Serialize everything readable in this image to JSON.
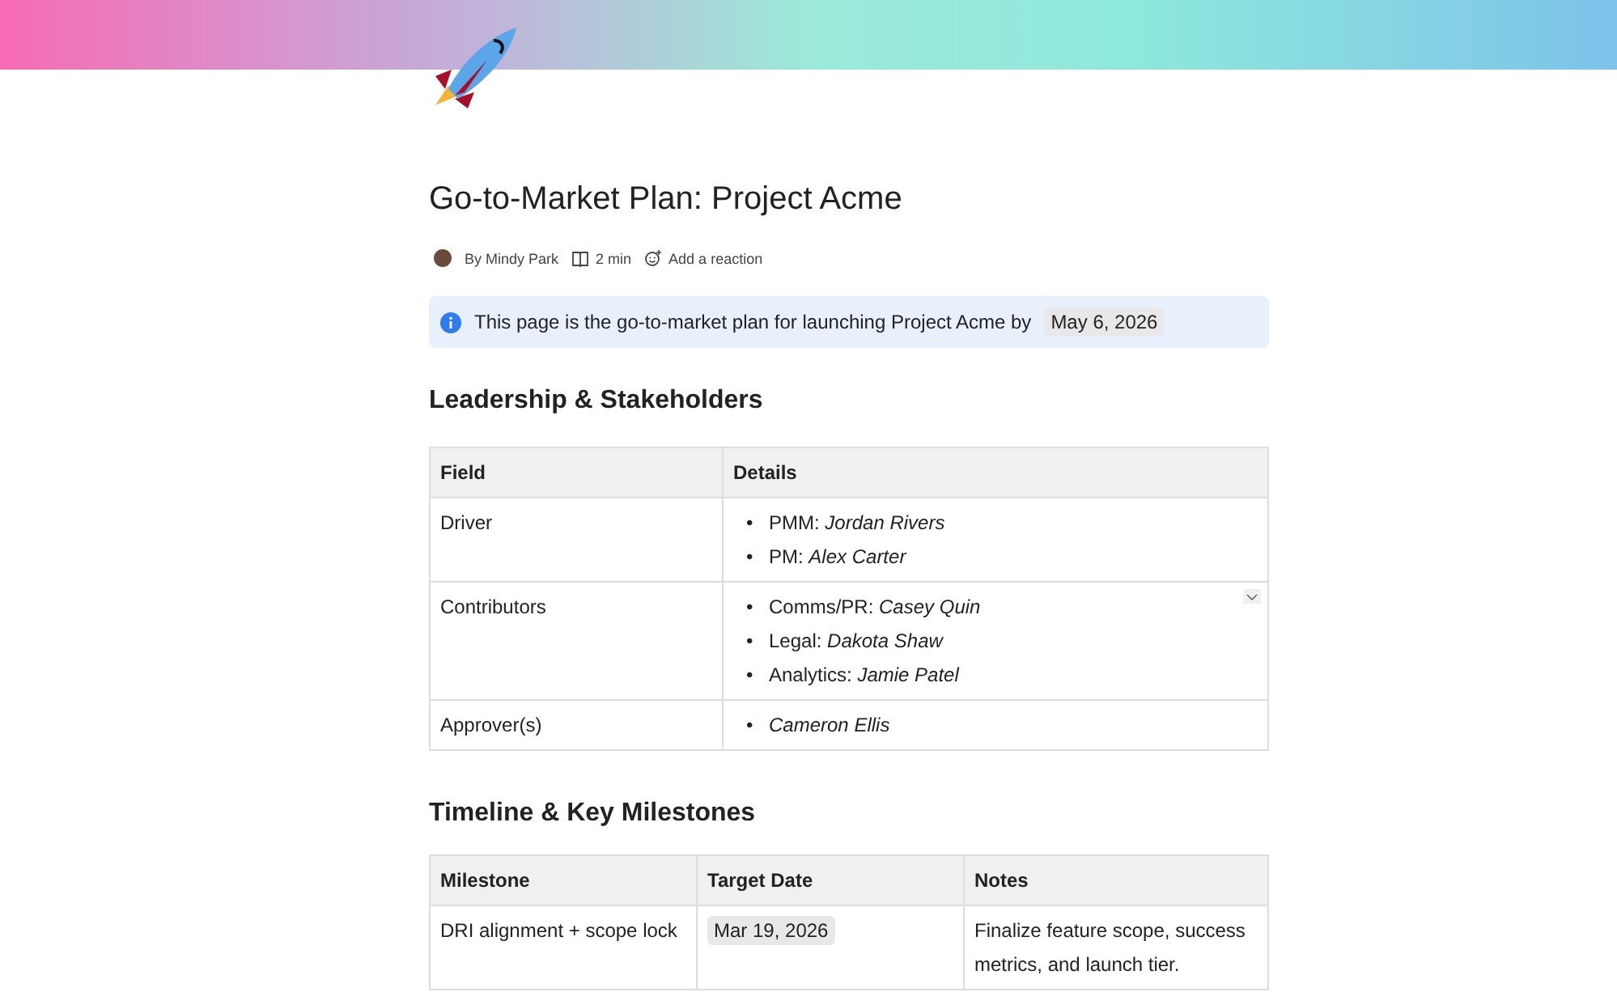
{
  "page": {
    "title": "Go-to-Market Plan: Project Acme",
    "author": "By Mindy Park",
    "read_time": "2 min",
    "reaction": "Add a reaction"
  },
  "callout": {
    "text": "This page is the go-to-market plan for launching Project Acme by",
    "date": "May 6, 2026"
  },
  "sections": [
    {
      "heading": "Leadership & Stakeholders",
      "table": {
        "columns": [
          "Field",
          "Details"
        ],
        "rows": [
          {
            "cells": [
              {
                "kind": "text",
                "text": "Driver"
              },
              {
                "kind": "list",
                "bullet": "•",
                "items": [
                  "PMM: *Jordan Rivers*",
                  "PM: *Alex Carter*"
                ]
              }
            ]
          },
          {
            "cells": [
              {
                "kind": "text",
                "text": "Contributors"
              },
              {
                "kind": "list",
                "bullet": "•",
                "items": [
                  "Comms/PR: *Casey Quin*",
                  "Legal: *Dakota Shaw*",
                  "Analytics: *Jamie Patel*"
                ],
                "menu": true
              }
            ]
          },
          {
            "cells": [
              {
                "kind": "text",
                "text": "Approver(s)"
              },
              {
                "kind": "list",
                "bullet": "•",
                "items": [
                  "*Cameron Ellis*"
                ]
              }
            ]
          }
        ]
      }
    },
    {
      "heading": "Timeline & Key Milestones",
      "table": {
        "columns": [
          "Milestone",
          "Target Date",
          "Notes"
        ],
        "rows": [
          {
            "cells": [
              {
                "kind": "text",
                "text": "DRI alignment + scope lock"
              },
              {
                "kind": "date",
                "text": "Mar 19, 2026"
              },
              {
                "kind": "text",
                "text": "Finalize feature scope, success metrics, and launch tier."
              }
            ]
          }
        ]
      }
    }
  ]
}
